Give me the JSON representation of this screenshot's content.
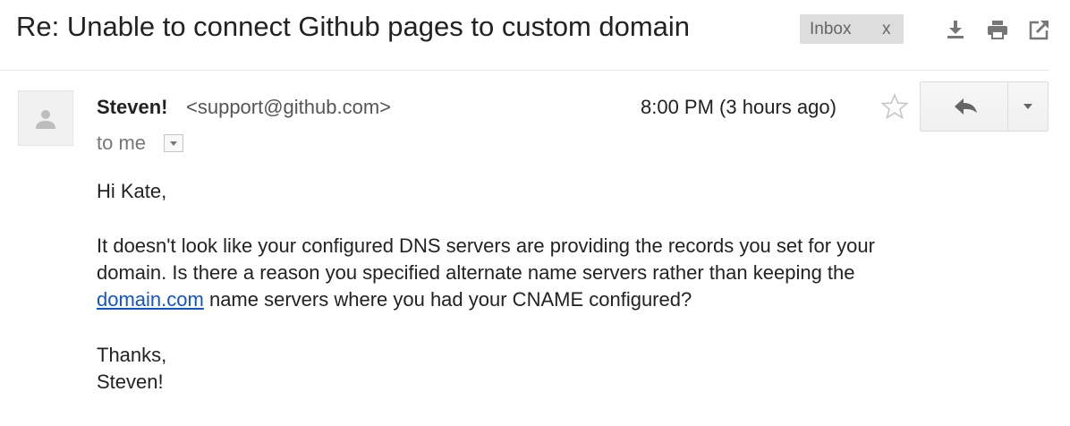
{
  "subject": "Re: Unable to connect Github pages to custom domain",
  "label": {
    "text": "Inbox",
    "remove": "x"
  },
  "toolbar_icons": [
    "download-icon",
    "print-icon",
    "open-in-new-window-icon"
  ],
  "sender": {
    "name": "Steven!",
    "email": "<support@github.com>"
  },
  "recipient": "to me",
  "timestamp": "8:00 PM (3 hours ago)",
  "body": {
    "greeting": "Hi Kate,",
    "line1": "It doesn't look like your configured DNS servers are providing the records you set for your",
    "line2": "domain. Is there a reason you specified alternate name servers rather than keeping the",
    "link": "domain.com",
    "line3_rest": " name servers where you had your CNAME configured?",
    "closing": "Thanks,",
    "signature": "Steven!"
  },
  "colors": {
    "link": "#1155cc",
    "chip_bg": "#dddddd",
    "text": "#222222",
    "muted": "#777777"
  }
}
